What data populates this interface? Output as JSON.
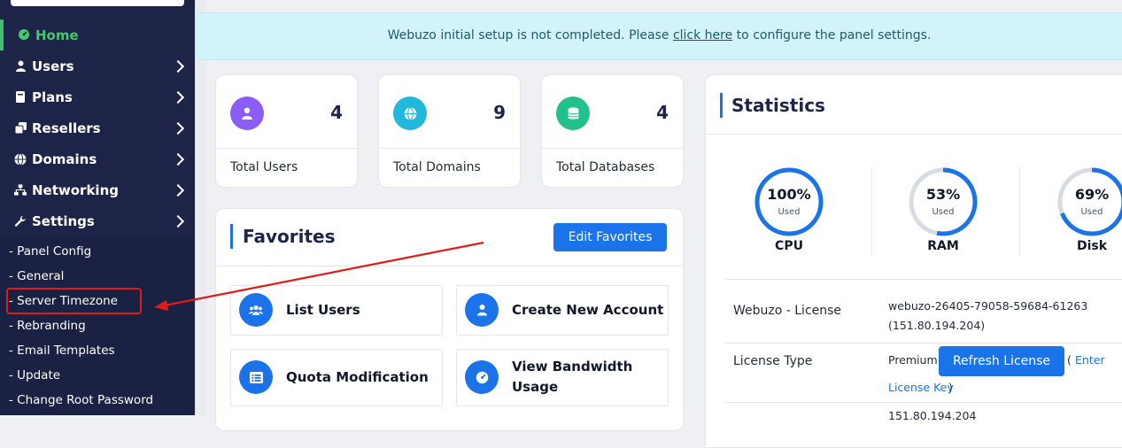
{
  "sidebar": {
    "home_label": "Home",
    "items": [
      {
        "label": "Users",
        "icon": "user-icon"
      },
      {
        "label": "Plans",
        "icon": "book-icon"
      },
      {
        "label": "Resellers",
        "icon": "copy-icon"
      },
      {
        "label": "Domains",
        "icon": "globe-icon"
      },
      {
        "label": "Networking",
        "icon": "network-icon"
      },
      {
        "label": "Settings",
        "icon": "wrench-icon"
      }
    ],
    "submenu": [
      "- Panel Config",
      "- General",
      "- Server Timezone",
      "- Rebranding",
      "- Email Templates",
      "- Update",
      "- Change Root Password"
    ]
  },
  "notice": {
    "prefix": "Webuzo initial setup is not completed. Please ",
    "link": "click here",
    "suffix": " to configure the panel settings."
  },
  "summary_cards": [
    {
      "value": "4",
      "label": "Total Users",
      "icon": "user-icon",
      "color": "#8b5cf6"
    },
    {
      "value": "9",
      "label": "Total Domains",
      "icon": "globe-icon",
      "color": "#22b8dd"
    },
    {
      "value": "4",
      "label": "Total Databases",
      "icon": "database-icon",
      "color": "#22c08a"
    }
  ],
  "favorites": {
    "title": "Favorites",
    "edit_button": "Edit Favorites",
    "items": [
      {
        "label": "List Users",
        "icon": "users-icon"
      },
      {
        "label": "Create New Account",
        "icon": "user-add-icon"
      },
      {
        "label": "Quota Modification",
        "icon": "list-icon"
      },
      {
        "label_line1": "View Bandwidth",
        "label_line2": "Usage",
        "icon": "gauge-icon"
      }
    ]
  },
  "statistics": {
    "title": "Statistics",
    "gauges": [
      {
        "name": "CPU",
        "percent": 100,
        "text": "100%",
        "sub": "Used"
      },
      {
        "name": "RAM",
        "percent": 53,
        "text": "53%",
        "sub": "Used"
      },
      {
        "name": "Disk",
        "percent": 69,
        "text": "69%",
        "sub": "Used"
      }
    ],
    "license": {
      "label": "Webuzo - License",
      "value_line1": "webuzo-26405-79058-59684-61263",
      "value_line2": "(151.80.194.204)"
    },
    "license_type": {
      "label": "License Type",
      "value": "Premium",
      "refresh_button": "Refresh License",
      "paren_open": "(",
      "enter_link_1": "Enter",
      "enter_link_2": "License Key",
      "paren_close": ")"
    },
    "next_row_value": "151.80.194.204"
  },
  "colors": {
    "sidebar_bg": "#1d2448",
    "accent": "#1a73e8",
    "home_active": "#44c870",
    "annotation_red": "#e01b1b"
  }
}
